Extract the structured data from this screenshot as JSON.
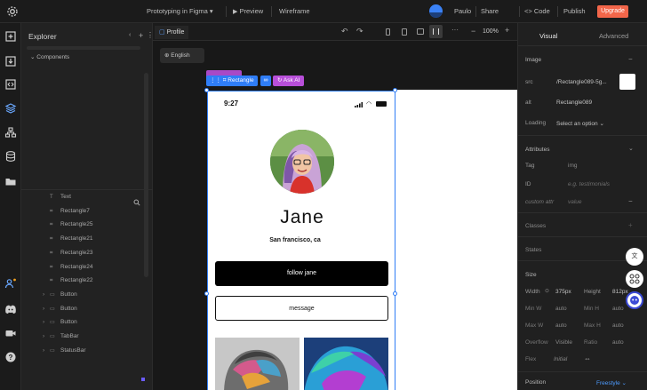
{
  "topbar": {
    "project_title": "Prototyping in Figma",
    "preview_label": "Preview",
    "wireframe_label": "Wireframe",
    "people_label": "Paulo",
    "share_label": "Share",
    "code_label": "<> Code",
    "publish_label": "Publish",
    "upgrade_label": "Upgrade",
    "avatar_color": "#3b82f6",
    "upgrade_color": "#f2664a"
  },
  "rail": {
    "icons": [
      "logo-icon",
      "add-page-icon",
      "import-icon",
      "code-block-icon",
      "layers-icon",
      "tree-icon",
      "database-icon",
      "folder-icon",
      "users-icon",
      "discord-icon",
      "video-icon",
      "help-icon"
    ]
  },
  "explorer": {
    "title": "Explorer",
    "section_label": "Components",
    "items": [
      {
        "label": "Text",
        "kind": "text"
      },
      {
        "label": "Rectangle7",
        "kind": "image"
      },
      {
        "label": "Rectangle25",
        "kind": "image"
      },
      {
        "label": "Rectangle21",
        "kind": "image"
      },
      {
        "label": "Rectangle23",
        "kind": "image"
      },
      {
        "label": "Rectangle24",
        "kind": "image"
      },
      {
        "label": "Rectangle22",
        "kind": "image"
      },
      {
        "label": "Button",
        "kind": "button"
      },
      {
        "label": "Button",
        "kind": "button"
      },
      {
        "label": "Button",
        "kind": "button"
      },
      {
        "label": "TabBar",
        "kind": "frame"
      },
      {
        "label": "StatusBar",
        "kind": "frame"
      }
    ]
  },
  "canvas": {
    "tab_label": "Profile",
    "language_label": "English",
    "zoom_label": "100%",
    "selection_tag": "Rectangle",
    "ask_ai_label": "Ask AI",
    "selection_color": "#2f7df6",
    "ai_color": "#b84fd9",
    "phone": {
      "time": "9:27",
      "name": "Jane",
      "location": "San francisco, ca",
      "follow_label": "follow jane",
      "message_label": "message"
    }
  },
  "panel": {
    "tabs": [
      "Visual",
      "Advanced"
    ],
    "image_section": "Image",
    "src_label": "src",
    "src_value": "/Rectangle089-5g...",
    "alt_label": "alt",
    "alt_value": "Rectangle089",
    "loading_label": "Loading",
    "loading_value": "Select an option",
    "attributes_section": "Attributes",
    "tag_label": "Tag",
    "tag_value": "img",
    "id_label": "ID",
    "id_placeholder": "e.g. testimonials",
    "custom_attr_label": "custom attr",
    "custom_attr_value": "value",
    "classes_section": "Classes",
    "states_section": "States",
    "size_section": "Size",
    "width_label": "Width",
    "width_value": "375px",
    "height_label": "Height",
    "height_value": "812px",
    "min_w_label": "Min W",
    "min_w_value": "auto",
    "min_h_label": "Min H",
    "min_h_value": "auto",
    "max_w_label": "Max W",
    "max_w_value": "auto",
    "max_h_label": "Max H",
    "max_h_value": "auto",
    "overflow_label": "Overflow",
    "overflow_value": "Visible",
    "ratio_label": "Ratio",
    "ratio_value": "auto",
    "flex_label": "Flex",
    "flex_value": "Initial",
    "position_section": "Position",
    "position_value": "Freestyle"
  }
}
